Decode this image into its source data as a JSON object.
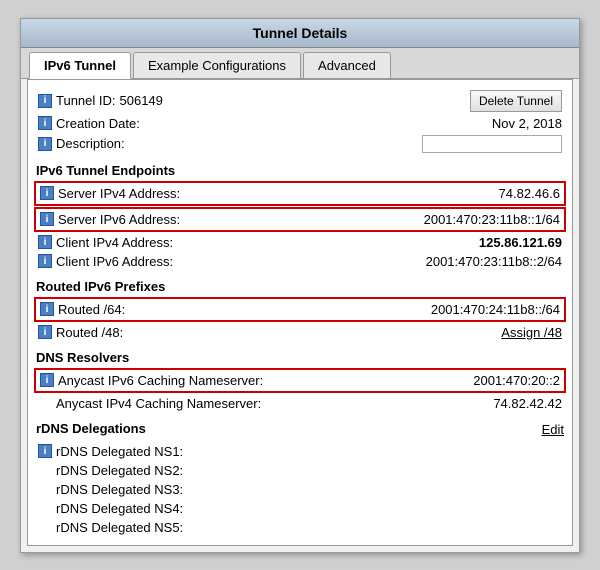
{
  "window": {
    "title": "Tunnel Details"
  },
  "tabs": [
    {
      "id": "ipv6-tunnel",
      "label": "IPv6 Tunnel",
      "active": true
    },
    {
      "id": "example-configs",
      "label": "Example Configurations",
      "active": false
    },
    {
      "id": "advanced",
      "label": "Advanced",
      "active": false
    }
  ],
  "buttons": {
    "delete_tunnel": "Delete Tunnel"
  },
  "fields": {
    "tunnel_id_label": "Tunnel ID:",
    "tunnel_id_value": "506149",
    "creation_date_label": "Creation Date:",
    "creation_date_value": "Nov 2, 2018",
    "description_label": "Description:"
  },
  "sections": {
    "endpoints": {
      "header": "IPv6 Tunnel Endpoints",
      "rows": [
        {
          "label": "Server IPv4 Address:",
          "value": "74.82.46.6",
          "highlighted": true,
          "bold": false
        },
        {
          "label": "Server IPv6 Address:",
          "value": "2001:470:23:11b8::1/64",
          "highlighted": true,
          "bold": false
        },
        {
          "label": "Client IPv4 Address:",
          "value": "125.86.121.69",
          "highlighted": false,
          "bold": true
        },
        {
          "label": "Client IPv6 Address:",
          "value": "2001:470:23:11b8::2/64",
          "highlighted": false,
          "bold": false
        }
      ]
    },
    "routed_prefixes": {
      "header": "Routed IPv6 Prefixes",
      "rows": [
        {
          "label": "Routed /64:",
          "value": "2001:470:24:11b8::/64",
          "highlighted": true,
          "bold": false
        },
        {
          "label": "Routed /48:",
          "value": "Assign /48",
          "highlighted": false,
          "bold": false,
          "link": true
        }
      ]
    },
    "dns_resolvers": {
      "header": "DNS Resolvers",
      "rows": [
        {
          "label": "Anycast IPv6 Caching Nameserver:",
          "value": "2001:470:20::2",
          "highlighted": true,
          "bold": false
        },
        {
          "label": "Anycast IPv4 Caching Nameserver:",
          "value": "74.82.42.42",
          "highlighted": false,
          "bold": false
        }
      ]
    },
    "rdns": {
      "header": "rDNS Delegations",
      "edit_label": "Edit",
      "rows": [
        {
          "label": "rDNS Delegated NS1:",
          "value": ""
        },
        {
          "label": "rDNS Delegated NS2:",
          "value": ""
        },
        {
          "label": "rDNS Delegated NS3:",
          "value": ""
        },
        {
          "label": "rDNS Delegated NS4:",
          "value": ""
        },
        {
          "label": "rDNS Delegated NS5:",
          "value": ""
        }
      ]
    }
  }
}
